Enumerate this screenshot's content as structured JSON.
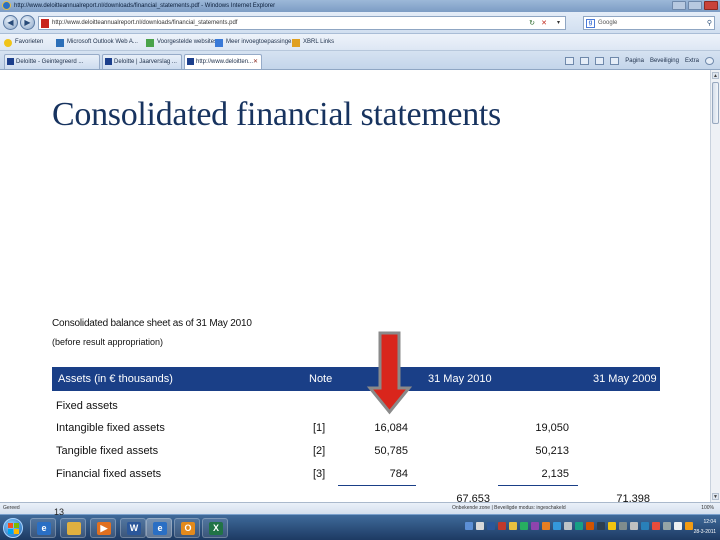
{
  "browser": {
    "window_title": "http://www.deloitteannualreport.nl/downloads/financial_statements.pdf - Windows Internet Explorer",
    "address_url": "http://www.deloitteannualreport.nl/downloads/financial_statements.pdf",
    "search_engine": "Google",
    "favorites_label": "Favorieten",
    "favorites": [
      {
        "label": "Microsoft Outlook Web A..."
      },
      {
        "label": "Voorgestelde websites"
      },
      {
        "label": "Meer invoegtoepassinge..."
      },
      {
        "label": "XBRL Links"
      }
    ],
    "tabs": [
      {
        "label": "Deloitte - Geintegreerd ..."
      },
      {
        "label": "Deloitte | Jaarverslag ..."
      },
      {
        "label": "http://www.deloitten..."
      }
    ],
    "commands": {
      "page": "Pagina",
      "safety": "Beveiliging",
      "extra": "Extra"
    },
    "status_text": "Gereed",
    "zone_text": "Onbekende zone | Beveiligde modus: ingeschakeld",
    "zoom": "100%"
  },
  "document": {
    "title": "Consolidated financial statements",
    "balance_sheet_title": "Consolidated balance sheet as of 31 May 2010",
    "balance_sheet_subtitle": "(before result appropriation)",
    "table_header": {
      "assets_label": "Assets",
      "assets_unit": "(in € thousands)",
      "note": "Note",
      "col_2010": "31 May 2010",
      "col_2009": "31 May 2009"
    },
    "section_label": "Fixed assets",
    "rows": [
      {
        "label": "Intangible fixed assets",
        "note": "[1]",
        "v2010": "16,084",
        "v2009": "19,050"
      },
      {
        "label": "Tangible fixed assets",
        "note": "[2]",
        "v2010": "50,785",
        "v2009": "50,213"
      },
      {
        "label": "Financial fixed assets",
        "note": "[3]",
        "v2010": "784",
        "v2009": "2,135"
      }
    ],
    "subtotal_2010": "67,653",
    "subtotal_2009": "71,398",
    "page_number": "13"
  },
  "annotation": {
    "arrow_color": "#d9261c",
    "arrow_border": "#8a8a8a"
  },
  "taskbar": {
    "time": "12:04",
    "date": "28-3-2011"
  },
  "colors": {
    "header_blue": "#1a3f87",
    "title_blue": "#17335f"
  }
}
